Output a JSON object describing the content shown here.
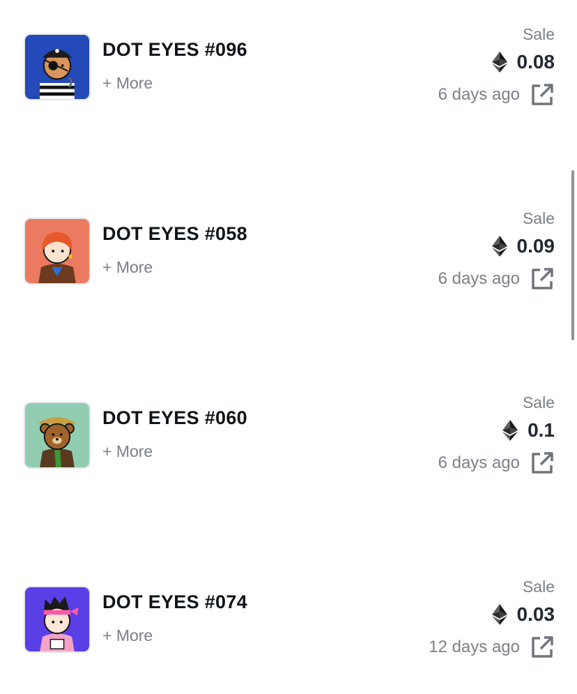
{
  "colors": {
    "title": "#0f1419",
    "muted": "#7b8089",
    "price": "#222831",
    "scrollbar": "#8f9399"
  },
  "activity": [
    {
      "title": "DOT EYES #096",
      "more": "+ More",
      "event": "Sale",
      "price": "0.08",
      "time": "6 days ago",
      "thumb_bg": "#2449b8"
    },
    {
      "title": "DOT EYES #058",
      "more": "+ More",
      "event": "Sale",
      "price": "0.09",
      "time": "6 days ago",
      "thumb_bg": "#ec7a60"
    },
    {
      "title": "DOT EYES #060",
      "more": "+ More",
      "event": "Sale",
      "price": "0.1",
      "time": "6 days ago",
      "thumb_bg": "#92cdb2"
    },
    {
      "title": "DOT EYES #074",
      "more": "+ More",
      "event": "Sale",
      "price": "0.03",
      "time": "12 days ago",
      "thumb_bg": "#5a3ee6"
    }
  ]
}
